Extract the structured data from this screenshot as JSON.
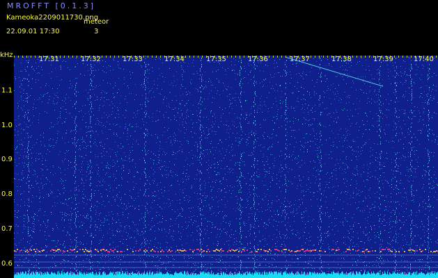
{
  "header": {
    "app_title": "MROFFT [0.1.3]",
    "filename": "Kameoka2209011730.png",
    "datetime": "22.09.01 17:30",
    "meteor_label": "meteor",
    "meteor_count": "3"
  },
  "spectrogram": {
    "unit_label": "kHz",
    "y_ticks": [
      "1.1",
      "1.0",
      "0.9",
      "0.8",
      "0.7",
      "0.6"
    ],
    "time_ticks": [
      "17:31",
      "17:32",
      "17:33",
      "17:34",
      "17:35",
      "17:36",
      "17:37",
      "17:38",
      "17:39",
      "17:40"
    ],
    "colors": {
      "background": "#0f1f8c",
      "noise": "#4fa3ff",
      "noise_hot": "#66ffff",
      "carrier": "#ff3b7a",
      "axis_text": "#ffff33",
      "title_text": "#8c8cff"
    }
  }
}
